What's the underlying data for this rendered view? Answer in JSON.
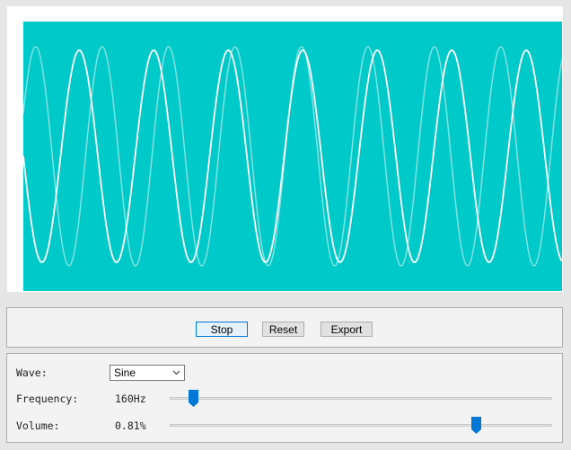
{
  "visualizer": {
    "background_color": "#00c9c9",
    "wave_color": "#ffffff",
    "faded_wave_color": "#7fe3e3"
  },
  "controls": {
    "stop_label": "Stop",
    "reset_label": "Reset",
    "export_label": "Export"
  },
  "settings": {
    "wave_label": "Wave:",
    "wave_value": "Sine",
    "frequency_label": "Frequency:",
    "frequency_value": "160Hz",
    "frequency_level": 0.05,
    "volume_label": "Volume:",
    "volume_value": "0.81%",
    "volume_level": 0.81,
    "slider_thumb_color": "#0078d7"
  }
}
